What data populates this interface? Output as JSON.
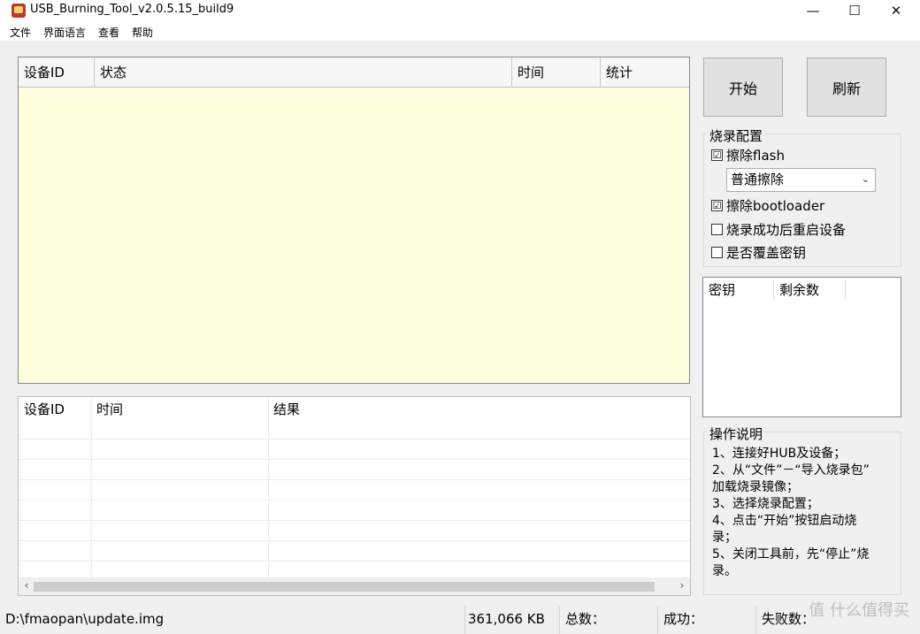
{
  "window": {
    "title": "USB_Burning_Tool_v2.0.5.15_build9",
    "controls": {
      "minimize": "—",
      "maximize": "☐",
      "close": "✕"
    }
  },
  "menu": [
    "文件",
    "界面语言",
    "查看",
    "帮助"
  ],
  "device_grid": {
    "columns": [
      "设备ID",
      "状态",
      "时间",
      "统计"
    ],
    "background": "#ffffe0"
  },
  "history_grid": {
    "columns": [
      "设备ID",
      "时间",
      "结果"
    ],
    "scroll_left": "‹",
    "scroll_right": "›"
  },
  "buttons": {
    "start": "开始",
    "refresh": "刷新"
  },
  "burn_config": {
    "title": "烧录配置",
    "erase_flash": {
      "label": "擦除flash",
      "checked": "☑"
    },
    "erase_mode": {
      "value": "普通擦除",
      "chevron": "⌄"
    },
    "erase_bootloader": {
      "label": "擦除bootloader",
      "checked": "☑"
    },
    "reboot_after": {
      "label": "烧录成功后重启设备",
      "checked": ""
    },
    "overwrite_key": {
      "label": "是否覆盖密钥",
      "checked": ""
    }
  },
  "key_table": {
    "columns": [
      "密钥",
      "剩余数"
    ]
  },
  "instructions": {
    "title": "操作说明",
    "lines": [
      "1、连接好HUB及设备；",
      "2、从“文件”－“导入烧录包”",
      "加载烧录镜像；",
      "3、选择烧录配置；",
      "4、点击“开始”按钮启动烧",
      "录；",
      "5、关闭工具前，先“停止”烧",
      "录。"
    ]
  },
  "status": {
    "path": "D:\\fmaopan\\update.img",
    "size": "361,066 KB",
    "total": "总数：",
    "success": "成功：",
    "fail": "失败数："
  },
  "watermark": "值 什么值得买"
}
